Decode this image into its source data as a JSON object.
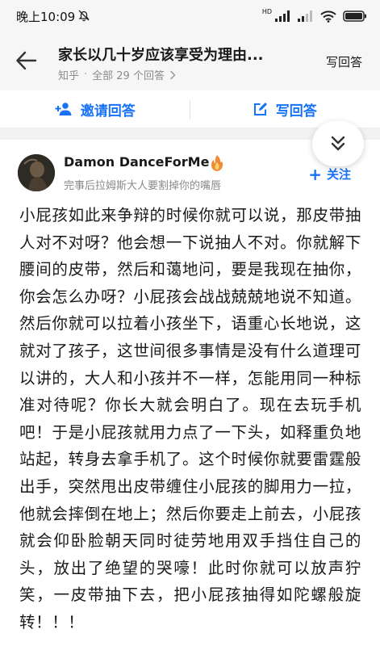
{
  "status_bar": {
    "time": "晚上10:09",
    "signal_label": "HD"
  },
  "header": {
    "title": "家长以几十岁应该享受为理由...",
    "source": "知乎",
    "answers_count": "全部 29 个回答",
    "write_answer": "写回答"
  },
  "actions": {
    "invite": "邀请回答",
    "write": "写回答"
  },
  "author": {
    "name": "Damon DanceForMe",
    "bio": "完事后拉姆斯大人要割掉你的嘴唇",
    "follow": "关注"
  },
  "answer": {
    "text": "小屁孩如此来争辩的时候你就可以说，那皮带抽人对不对呀？他会想一下说抽人不对。你就解下腰间的皮带，然后和蔼地问，要是我现在抽你，你会怎么办呀？小屁孩会战战兢兢地说不知道。然后你就可以拉着小孩坐下，语重心长地说，这就对了孩子，这世间很多事情是没有什么道理可以讲的，大人和小孩并不一样，怎能用同一种标准对待呢？你长大就会明白了。现在去玩手机吧！于是小屁孩就用力点了一下头，如释重负地站起，转身去拿手机了。这个时候你就要雷霆般出手，突然甩出皮带缠住小屁孩的脚用力一拉，他就会摔倒在地上；然后你要走上前去，小屁孩就会仰卧脸朝天同时徒劳地用双手挡住自己的头，放出了绝望的哭嚎！此时你就可以放声狞笑，一皮带抽下去，把小屁孩抽得如陀螺般旋转！！！"
  },
  "colors": {
    "accent": "#1772f6",
    "header_bg": "#f6f6f6",
    "muted_text": "#8a8a8a"
  },
  "icons": {
    "status_left": "do-not-disturb-icon",
    "status_right": [
      "cellular-signal-icon",
      "wifi-icon",
      "battery-icon"
    ],
    "back": "back-arrow-icon",
    "chevron": "chevron-right-icon",
    "invite": "add-person-icon",
    "write": "edit-icon",
    "collapse": "double-chevron-down-icon",
    "follow": "plus-icon"
  }
}
